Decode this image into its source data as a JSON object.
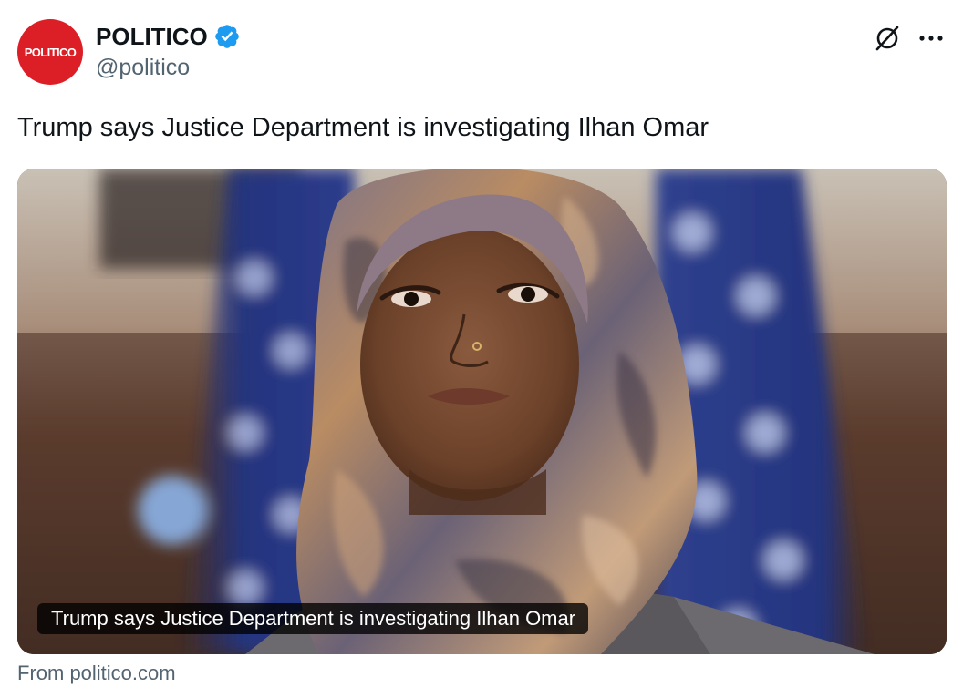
{
  "account": {
    "avatar_wordmark": "POLITICO",
    "avatar_color": "#dc1f26",
    "display_name": "POLITICO",
    "handle": "@politico",
    "verified_icon": "verified-badge-icon",
    "verified_color": "#1d9bf0"
  },
  "header_actions": {
    "grok_icon": "grok-icon",
    "more_icon": "more-options-icon"
  },
  "tweet": {
    "text": "Trump says Justice Department is investigating Ilhan Omar"
  },
  "card": {
    "caption": "Trump says Justice Department is investigating Ilhan Omar",
    "source": "From politico.com"
  },
  "colors": {
    "text_primary": "#0f1419",
    "text_secondary": "#536471",
    "brand_red": "#dc1f26",
    "verified_blue": "#1d9bf0"
  }
}
